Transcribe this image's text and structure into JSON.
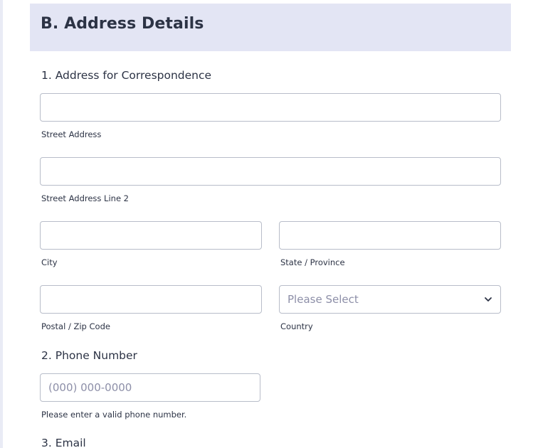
{
  "section": {
    "title": "B. Address Details"
  },
  "address": {
    "label": "1. Address for Correspondence",
    "street1": {
      "value": "",
      "sublabel": "Street Address"
    },
    "street2": {
      "value": "",
      "sublabel": "Street Address Line 2"
    },
    "city": {
      "value": "",
      "sublabel": "City"
    },
    "state": {
      "value": "",
      "sublabel": "State / Province"
    },
    "postal": {
      "value": "",
      "sublabel": "Postal / Zip Code"
    },
    "country": {
      "selected": "Please Select",
      "sublabel": "Country",
      "icon": "chevron-down-icon"
    }
  },
  "phone": {
    "label": "2. Phone Number",
    "placeholder": "(000) 000-0000",
    "sublabel": "Please enter a valid phone number."
  },
  "email": {
    "label": "3. Email"
  },
  "colors": {
    "header_bg": "#e3e5f4",
    "text": "#2c3345",
    "border": "#b8bdc9",
    "placeholder": "#8d8fa8"
  }
}
